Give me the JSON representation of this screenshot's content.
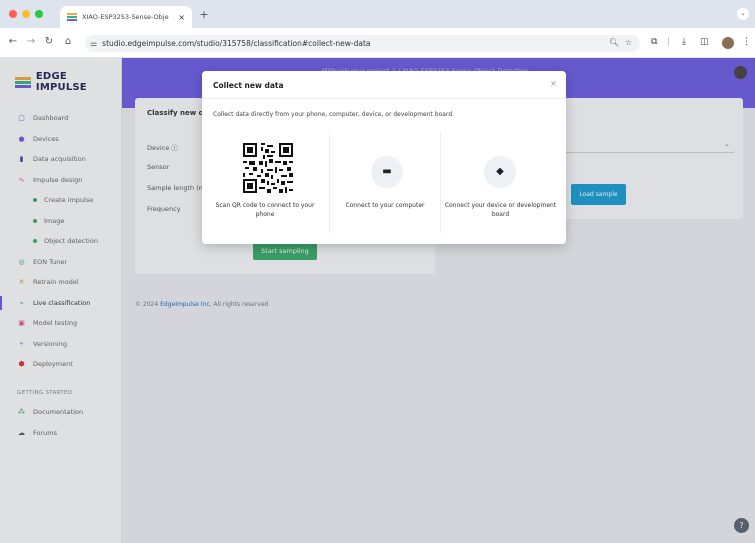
{
  "browser": {
    "tab_title": "XIAO-ESP32S3-Sense-Obje",
    "tab_close": "×",
    "new_tab": "+",
    "tab_menu": "⌄",
    "url": "studio.edgeimpulse.com/studio/315758/classification#collect-new-data",
    "icons": [
      "back-icon",
      "forward-icon",
      "reload-icon",
      "home-icon",
      "site-info-icon",
      "zoom-icon",
      "bookmark-star-icon",
      "extensions-icon",
      "download-icon",
      "sidepanel-icon",
      "profile-avatar",
      "kebab-menu-icon"
    ],
    "traffic_light_colors": [
      "#ff5f57",
      "#febc2e",
      "#28c840"
    ]
  },
  "sidebar": {
    "logo_text": "EDGE IMPULSE",
    "logo_colors": [
      "#f0a53a",
      "#36b37e",
      "#6c5ddb"
    ],
    "items": [
      {
        "label": "Dashboard",
        "icon": "dashboard-icon",
        "color": "#6c5ddb"
      },
      {
        "label": "Devices",
        "icon": "devices-icon",
        "color": "#6c5ddb"
      },
      {
        "label": "Data acquisition",
        "icon": "database-icon",
        "color": "#3f3fa0"
      },
      {
        "label": "Impulse design",
        "icon": "impulse-icon",
        "color": "#e0507a"
      },
      {
        "label": "Create impulse",
        "sub": true
      },
      {
        "label": "Image",
        "sub": true
      },
      {
        "label": "Object detection",
        "sub": true
      },
      {
        "label": "EON Tuner",
        "icon": "tuner-icon",
        "color": "#3aaa6a"
      },
      {
        "label": "Retrain model",
        "icon": "retrain-icon",
        "color": "#e59a2e"
      },
      {
        "label": "Live classification",
        "icon": "live-classification-icon",
        "color": "#3aaa6a",
        "active": true
      },
      {
        "label": "Model testing",
        "icon": "model-testing-icon",
        "color": "#e0507a"
      },
      {
        "label": "Versioning",
        "icon": "versioning-icon",
        "color": "#6c5ddb"
      },
      {
        "label": "Deployment",
        "icon": "deployment-icon",
        "color": "#d9303a"
      }
    ],
    "section_label": "GETTING STARTED",
    "getting_started": [
      {
        "label": "Documentation",
        "icon": "documentation-icon"
      },
      {
        "label": "Forums",
        "icon": "forums-icon"
      }
    ]
  },
  "header": {
    "breadcrumb": "Mithunkumar-project-1 / XIAO-ESP32S3-Sense-Object-Detection"
  },
  "classify_card": {
    "title": "Classify new da",
    "device_label": "Device ⓘ",
    "sensor_label": "Sensor",
    "sample_length_label": "Sample length (ms.)",
    "frequency_label": "Frequency",
    "start_button": "Start sampling"
  },
  "load_card": {
    "load_button": "Load sample"
  },
  "footer": {
    "prefix": "© 2024 ",
    "link": "EdgeImpulse Inc.",
    "suffix": " All rights reserved"
  },
  "help_button": "?",
  "modal": {
    "title": "Collect new data",
    "close": "×",
    "description": "Collect data directly from your phone, computer, device, or development board.",
    "options": [
      {
        "label": "Scan QR code to connect to your phone",
        "icon": "qr-code-icon"
      },
      {
        "label": "Connect to your computer",
        "icon": "laptop-icon"
      },
      {
        "label": "Connect your device or development board",
        "icon": "chip-icon"
      }
    ]
  }
}
